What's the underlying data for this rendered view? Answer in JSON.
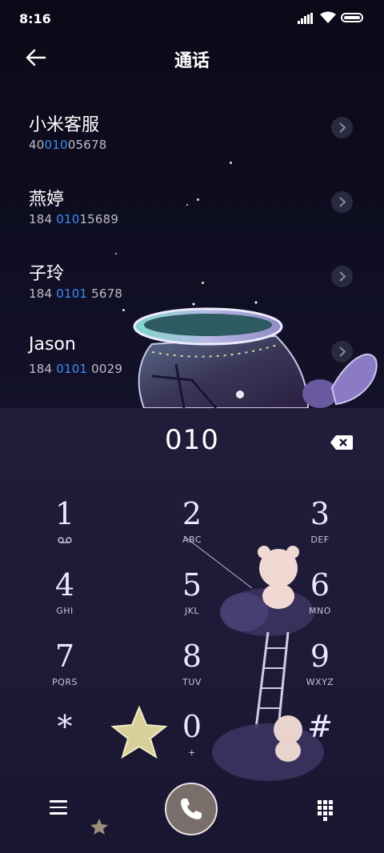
{
  "status_bar": {
    "time": "8:16"
  },
  "header": {
    "title": "通话"
  },
  "contacts": [
    {
      "name": "小米客服",
      "number_pre": "40",
      "number_hl": "010",
      "number_post": "05678"
    },
    {
      "name": "燕婷",
      "number_pre": "184 ",
      "number_hl": "010",
      "number_post": "15689"
    },
    {
      "name": "子玲",
      "number_pre": "184 ",
      "number_hl": "0101",
      "number_post": " 5678"
    },
    {
      "name": "Jason",
      "number_pre": "184 ",
      "number_hl": "0101",
      "number_post": " 0029"
    }
  ],
  "dialer": {
    "digits": "010",
    "keys": [
      {
        "digit": "1",
        "letters": ""
      },
      {
        "digit": "2",
        "letters": "ABC"
      },
      {
        "digit": "3",
        "letters": "DEF"
      },
      {
        "digit": "4",
        "letters": "GHI"
      },
      {
        "digit": "5",
        "letters": "JKL"
      },
      {
        "digit": "6",
        "letters": "MNO"
      },
      {
        "digit": "7",
        "letters": "PQRS"
      },
      {
        "digit": "8",
        "letters": "TUV"
      },
      {
        "digit": "9",
        "letters": "WXYZ"
      },
      {
        "digit": "*",
        "letters": ""
      },
      {
        "digit": "0",
        "letters": "+"
      },
      {
        "digit": "#",
        "letters": ""
      }
    ]
  },
  "colors": {
    "highlight": "#3d8cf5",
    "call_button": "#7a6e6a"
  },
  "icons": [
    "back-arrow-icon",
    "chevron-right-icon",
    "backspace-icon",
    "menu-icon",
    "phone-icon",
    "dialpad-icon",
    "voicemail-icon"
  ]
}
